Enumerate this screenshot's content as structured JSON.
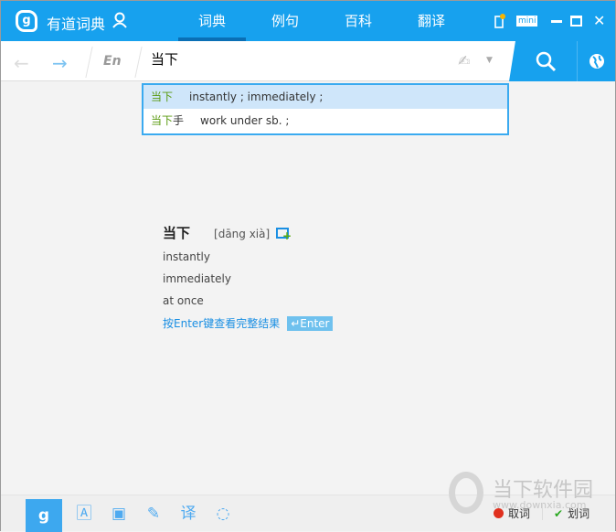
{
  "app": {
    "title": "有道词典"
  },
  "tabs": [
    {
      "label": "词典",
      "active": true
    },
    {
      "label": "例句"
    },
    {
      "label": "百科"
    },
    {
      "label": "翻译"
    }
  ],
  "window_controls": {
    "mini": "mini"
  },
  "toolbar": {
    "lang": "En",
    "query": "当下"
  },
  "suggestions": [
    {
      "word": "当下",
      "extra": "",
      "meaning": "instantly ; immediately ;"
    },
    {
      "word": "当下",
      "extra": "手",
      "meaning": "work under sb. ;"
    }
  ],
  "result": {
    "word": "当下",
    "pronunciation": "[dāng xià]",
    "definitions": [
      "instantly",
      "immediately",
      "at once"
    ],
    "full_hint": "按Enter键查看完整结果",
    "enter_label": "↵Enter"
  },
  "bottom": {
    "cancel_label": "取词",
    "select_label": "划词"
  },
  "watermark": {
    "name": "当下软件园",
    "url": "www.downxia.com"
  },
  "colors": {
    "accent": "#17a1ee",
    "highlight": "#5a9a10"
  }
}
